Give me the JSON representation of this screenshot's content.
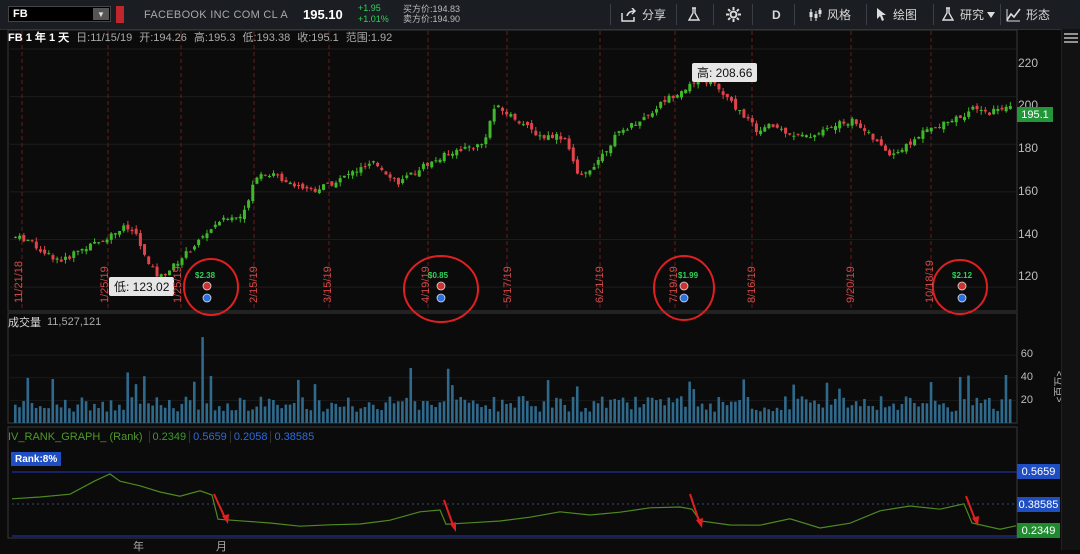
{
  "toolbar": {
    "symbol": "FB",
    "description": "FACEBOOK INC COM CL A",
    "last": "195.10",
    "change": "+1.95",
    "change_pct": "+1.01%",
    "bid": "买方价:194.83",
    "ask": "卖方价:194.90",
    "share_label": "分享",
    "period_label": "D",
    "style_label": "风格",
    "drawing_label": "绘图",
    "study_label": "研究",
    "pattern_label": "形态"
  },
  "price_panel": {
    "symbol": "FB",
    "timeframe": "1 年 1 天",
    "date": "日:11/15/19",
    "open": "开:194.26",
    "high": "高:195.3",
    "low": "低:193.38",
    "close": "收:195.1",
    "range": "范围:1.92",
    "y_ticks": [
      "220",
      "200",
      "180",
      "160",
      "140",
      "120"
    ],
    "current_price_tag": "195.1",
    "high_callout": "高: 208.66",
    "low_callout": "低: 123.02",
    "date_labels": [
      "11/21/18",
      "1/25/19",
      "2/15/19",
      "3/15/19",
      "4/19/19",
      "5/17/19",
      "6/21/19",
      "7/19/19",
      "8/16/19",
      "9/20/19",
      "10/18/19"
    ],
    "earnings": [
      "$2.38",
      "$0.85",
      "$1.99",
      "$2.12"
    ]
  },
  "volume_panel": {
    "label": "成交量",
    "value": "11,527,121",
    "y_ticks": [
      "60",
      "40",
      "20"
    ],
    "unit": "<百万>"
  },
  "iv_panel": {
    "label": "IV_RANK_GRAPH_ (Rank)",
    "values": [
      "0.2349",
      "0.5659",
      "0.2058",
      "0.38585"
    ],
    "rank_badge": "Rank:8%",
    "right_tags": [
      "0.5659",
      "0.38585",
      "0.2349"
    ]
  },
  "x_axis": {
    "labels": [
      "年",
      "月"
    ]
  },
  "colors": {
    "up": "#3fb92a",
    "down": "#e0434a",
    "volume": "#2f6a8c",
    "iv_line": "#4e8a1f",
    "annotation": "#e02020",
    "price_tag": "#23963a",
    "blue_tag": "#1f4ec2",
    "green_tag": "#1f8a2e"
  },
  "chart_data": {
    "type": "candlestick",
    "x_range": [
      "11/15/18",
      "11/15/19"
    ],
    "ylim": [
      110,
      228
    ],
    "approx_close_series": [
      141,
      140,
      136,
      133,
      131,
      135,
      137,
      139,
      142,
      145,
      143,
      130,
      124,
      128,
      133,
      138,
      143,
      148,
      149,
      150,
      167,
      168,
      166,
      164,
      162,
      161,
      163,
      165,
      168,
      170,
      172,
      168,
      164,
      167,
      171,
      173,
      176,
      178,
      179,
      180,
      196,
      193,
      190,
      186,
      183,
      184,
      182,
      165,
      170,
      176,
      183,
      187,
      190,
      193,
      198,
      201,
      204,
      206,
      207,
      201,
      196,
      191,
      185,
      188,
      186,
      184,
      183,
      185,
      187,
      189,
      190,
      185,
      180,
      176,
      178,
      182,
      186,
      187,
      190,
      192,
      195,
      193,
      195,
      195.1
    ],
    "high": 208.66,
    "low": 123.02
  }
}
